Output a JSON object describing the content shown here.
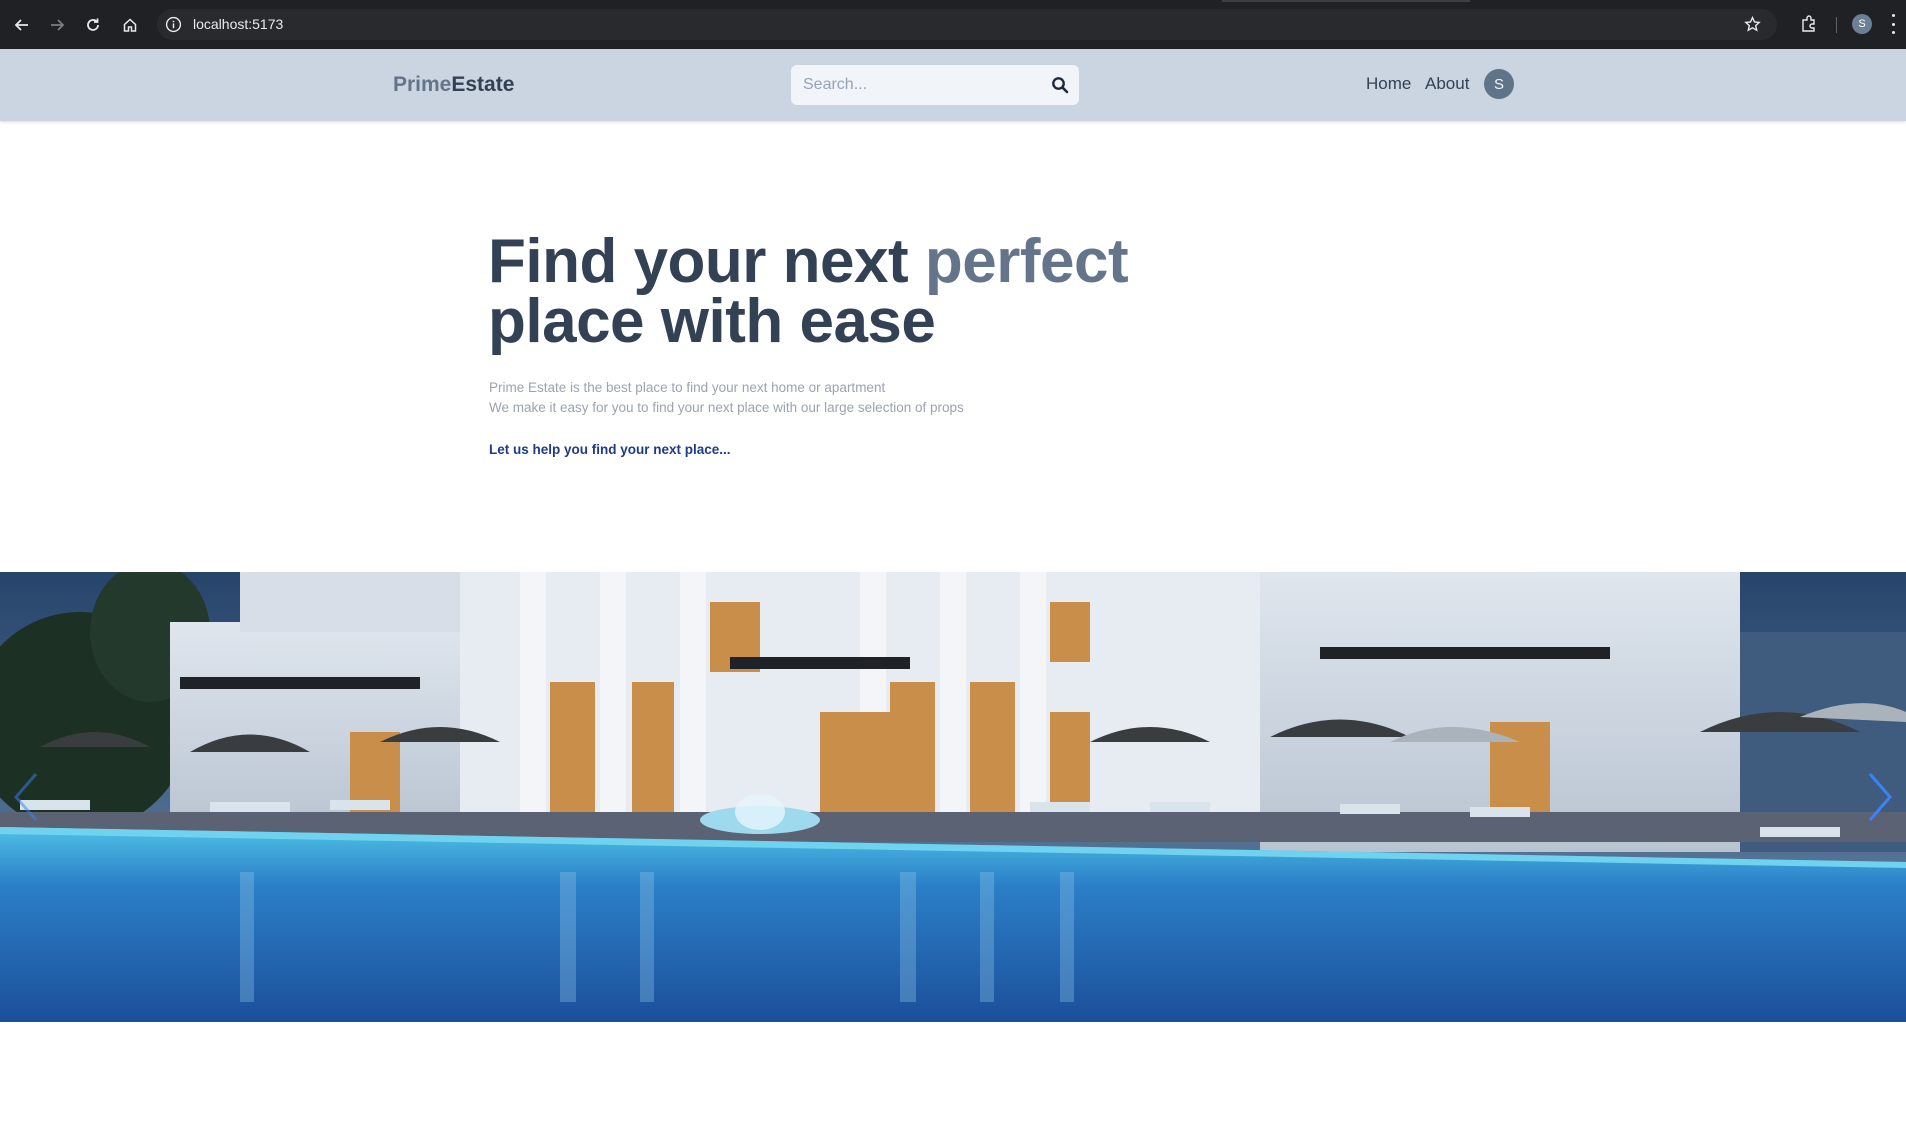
{
  "browser": {
    "url": "localhost:5173",
    "profile_initial": "S"
  },
  "header": {
    "logo_part1": "Prime",
    "logo_part2": "Estate",
    "search_placeholder": "Search...",
    "nav": {
      "home": "Home",
      "about": "About"
    },
    "avatar_initial": "S"
  },
  "hero": {
    "title_part1": "Find your next ",
    "title_accent": "perfect",
    "title_line2": "place with ease",
    "subtitle_line1": "Prime Estate is the best place to find your next home or apartment",
    "subtitle_line2": "We make it easy for you to find your next place with our large selection of props",
    "cta": "Let us help you find your next place..."
  },
  "slider": {
    "image_description_icon": "luxury-villa-pool-photo",
    "prev_icon": "chevron-left-icon",
    "next_icon": "chevron-right-icon",
    "arrow_color": "#3b82f6"
  },
  "colors": {
    "header_bg": "#cbd5e1",
    "title": "#334155",
    "accent": "#64748b",
    "cta": "#1e3a8a"
  }
}
